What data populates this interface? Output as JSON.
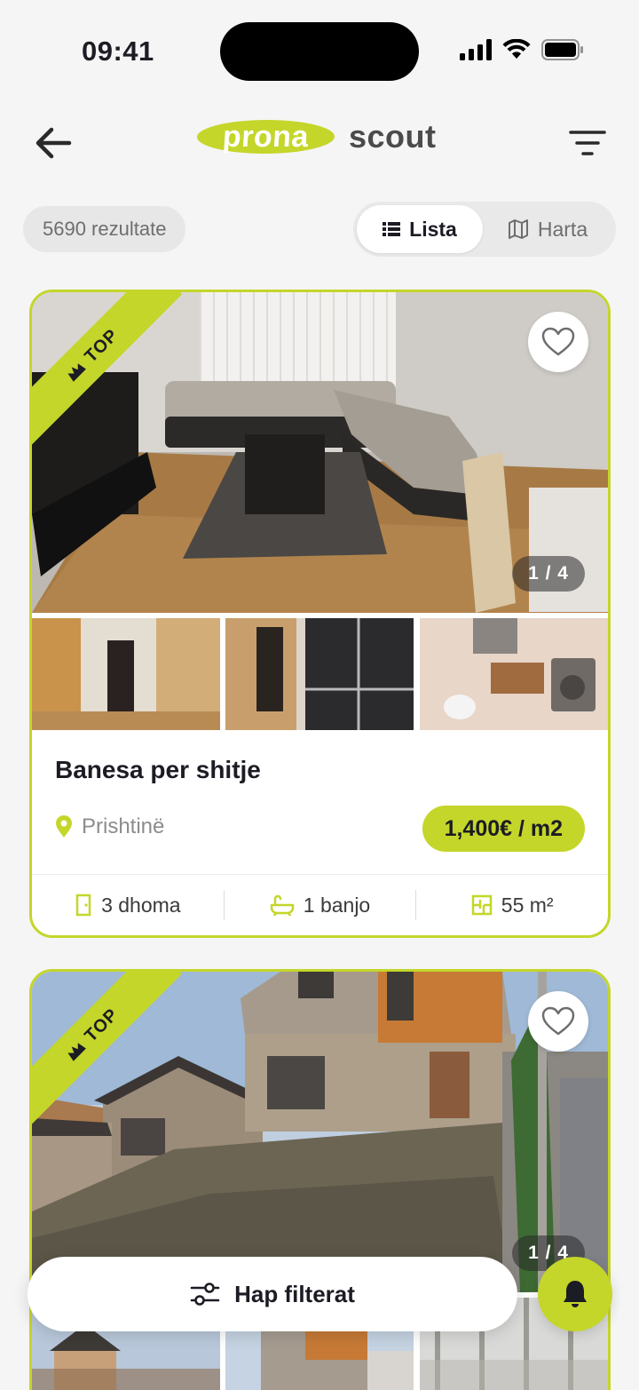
{
  "status_bar": {
    "time": "09:41"
  },
  "header": {
    "logo_part1": "prona",
    "logo_part2": "scout",
    "back_icon": "arrow-left-icon",
    "filter_icon": "filter-lines-icon"
  },
  "results": {
    "count_label": "5690 rezultate",
    "view_list_label": "Lista",
    "view_map_label": "Harta",
    "active_view": "Lista"
  },
  "listings": [
    {
      "badge": "TOP",
      "photo_counter": "1 / 4",
      "title": "Banesa per shitje",
      "location": "Prishtinë",
      "price": "1,400€ / m2",
      "rooms": "3 dhoma",
      "baths": "1 banjo",
      "area": "55 m²"
    },
    {
      "badge": "TOP",
      "photo_counter": "1 / 4"
    }
  ],
  "bottom": {
    "open_filters_label": "Hap filterat",
    "bell_icon": "bell-icon"
  },
  "colors": {
    "accent": "#c4d62a",
    "background": "#f5f5f5",
    "text": "#1c1c24"
  }
}
